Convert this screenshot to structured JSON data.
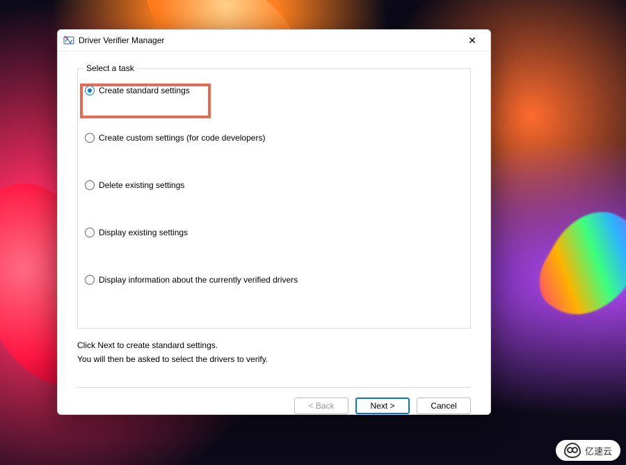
{
  "window": {
    "title": "Driver Verifier Manager"
  },
  "task": {
    "legend": "Select a task",
    "options": [
      {
        "label": "Create standard settings",
        "selected": true
      },
      {
        "label": "Create custom settings (for code developers)",
        "selected": false
      },
      {
        "label": "Delete existing settings",
        "selected": false
      },
      {
        "label": "Display existing settings",
        "selected": false
      },
      {
        "label": "Display information about the currently verified drivers",
        "selected": false
      }
    ],
    "highlighted_index": 0
  },
  "info": {
    "line1": "Click Next to create standard settings.",
    "line2": "You will then be asked to select the drivers to verify."
  },
  "buttons": {
    "back": "< Back",
    "next": "Next >",
    "cancel": "Cancel"
  },
  "watermark": "亿速云"
}
